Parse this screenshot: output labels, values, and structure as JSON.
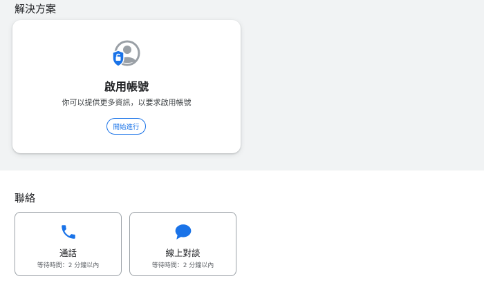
{
  "solutions": {
    "title": "解決方案",
    "card": {
      "icon": "account-shield-icon",
      "title": "啟用帳號",
      "description": "你可以提供更多資訊，以要求啟用帳號",
      "button_label": "開始進行"
    }
  },
  "contact": {
    "title": "聯絡",
    "options": [
      {
        "icon": "phone-icon",
        "label": "通話",
        "wait": "等待時間：2 分鐘以內"
      },
      {
        "icon": "chat-icon",
        "label": "線上對談",
        "wait": "等待時間：2 分鐘以內"
      }
    ]
  },
  "colors": {
    "accent": "#1a73e8",
    "band_background": "#f1f3f4",
    "icon_gray": "#9aa0a6"
  }
}
